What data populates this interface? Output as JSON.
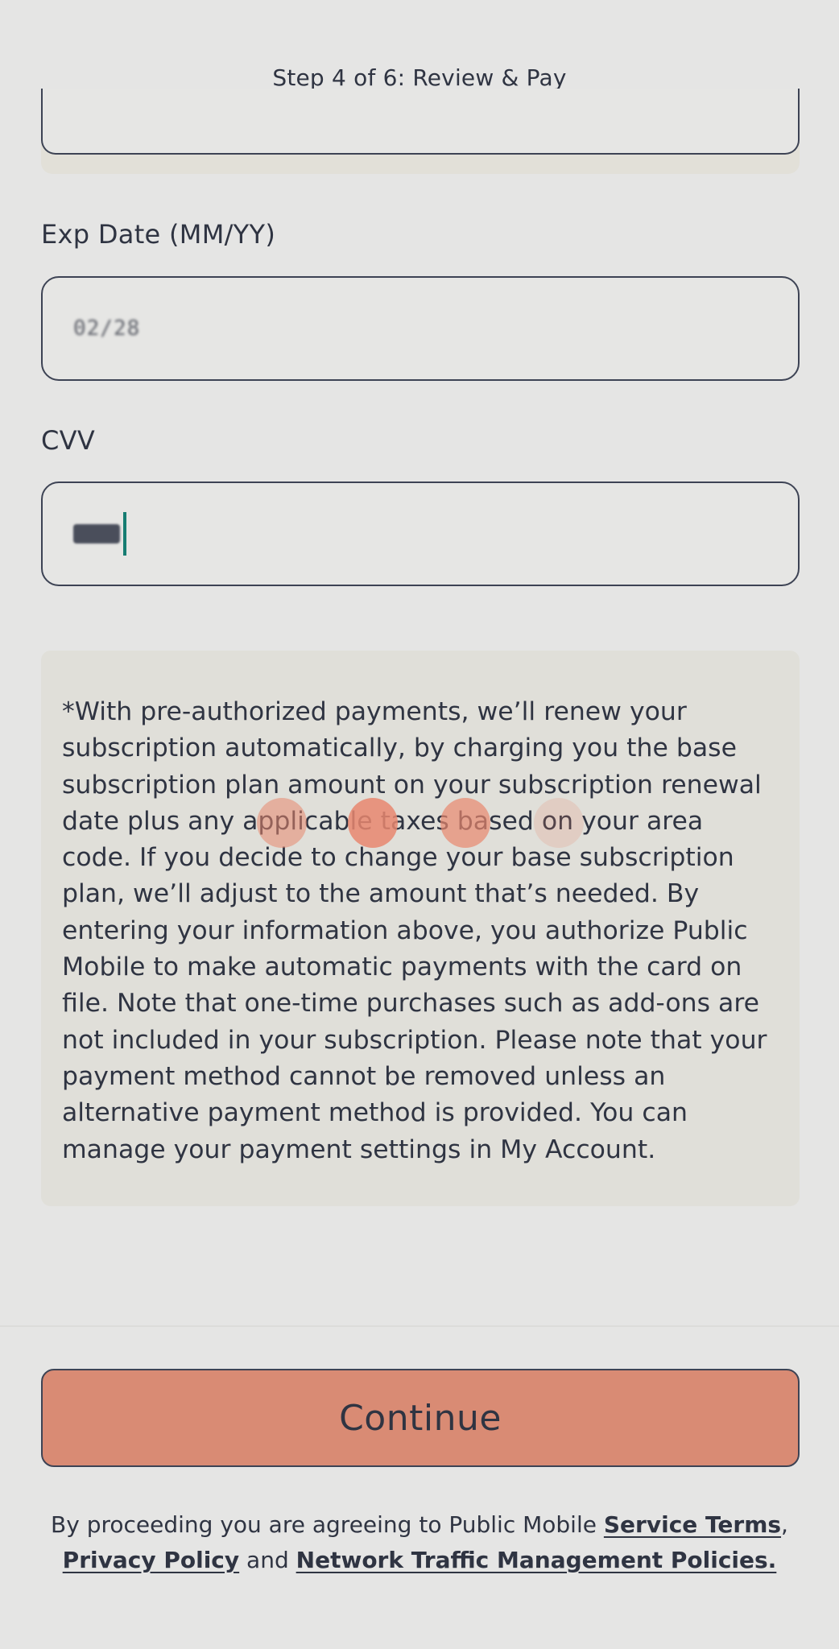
{
  "header": {
    "step_label": "Step 4 of 6: Review & Pay"
  },
  "form": {
    "exp_label": "Exp Date (MM/YY)",
    "exp_value": "02/28",
    "cvv_label": "CVV"
  },
  "notice": {
    "text": "*With pre-authorized payments, we’ll renew your subscription automatically, by charging you the base subscription plan amount on your subscription renewal date plus any applicable taxes based on your area code. If you decide to change your base subscription plan, we’ll adjust to the amount that’s needed. By entering your information above, you authorize Public Mobile to make automatic payments with the card on file. Note that one-time purchases such as add-ons are not included in your subscription. Please note that your payment method cannot be removed unless an alternative payment method is provided. You can manage your payment settings in My Account."
  },
  "actions": {
    "continue_label": "Continue"
  },
  "legal": {
    "prefix": "By proceeding you are agreeing to Public Mobile ",
    "service_terms": "Service Terms",
    "comma": ",",
    "privacy_policy": "Privacy Policy",
    "and": " and ",
    "network_policy": "Network Traffic Management Policies."
  },
  "colors": {
    "accent_button": "#d98b74",
    "cursor": "#167d72",
    "text": "#2f3442"
  }
}
